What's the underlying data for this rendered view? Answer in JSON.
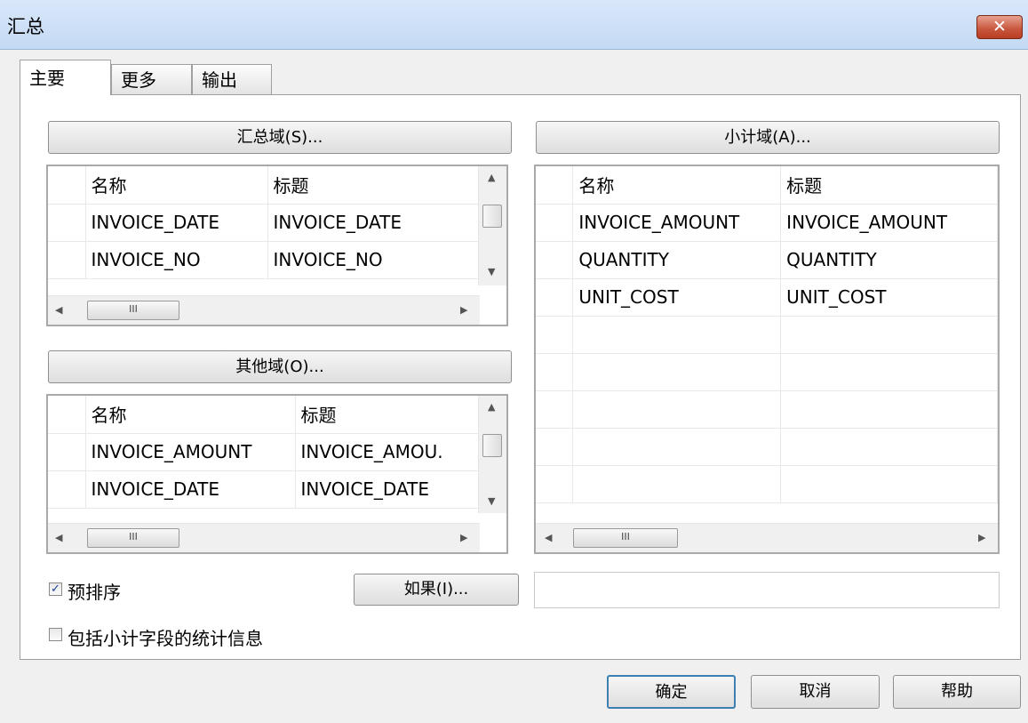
{
  "window": {
    "title": "汇总",
    "close_icon": "close-icon"
  },
  "tabs": [
    {
      "label": "主要",
      "active": true
    },
    {
      "label": "更多",
      "active": false
    },
    {
      "label": "输出",
      "active": false
    }
  ],
  "summary": {
    "button_label": "汇总域(S)...",
    "headers": [
      "名称",
      "标题"
    ],
    "rows": [
      [
        "INVOICE_DATE",
        "INVOICE_DATE"
      ],
      [
        "INVOICE_NO",
        "INVOICE_NO"
      ]
    ],
    "hscroll_grip": "III"
  },
  "other": {
    "button_label": "其他域(O)...",
    "headers": [
      "名称",
      "标题"
    ],
    "rows": [
      [
        "INVOICE_AMOUNT",
        "INVOICE_AMOU."
      ],
      [
        "INVOICE_DATE",
        "INVOICE_DATE"
      ]
    ],
    "hscroll_grip": "III"
  },
  "subtotal": {
    "button_label": "小计域(A)...",
    "headers": [
      "名称",
      "标题"
    ],
    "rows": [
      [
        "INVOICE_AMOUNT",
        "INVOICE_AMOUNT"
      ],
      [
        "QUANTITY",
        "QUANTITY"
      ],
      [
        "UNIT_COST",
        "UNIT_COST"
      ]
    ],
    "hscroll_grip": "III"
  },
  "options": {
    "presort_label": "预排序",
    "presort_checked": true,
    "include_stats_label": "包括小计字段的统计信息",
    "include_stats_checked": false,
    "if_button_label": "如果(I)...",
    "if_value": ""
  },
  "footer": {
    "ok_label": "确定",
    "cancel_label": "取消",
    "help_label": "帮助"
  },
  "colors": {
    "titlebar": "#c4d9f3",
    "close": "#c7553c",
    "ok_border": "#3c7fb1"
  }
}
